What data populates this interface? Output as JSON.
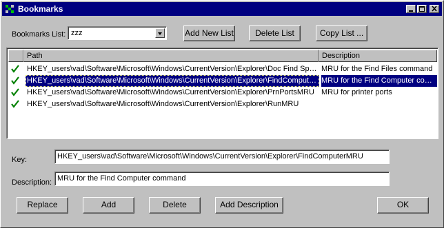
{
  "window": {
    "title": "Bookmarks"
  },
  "bookmarks_list": {
    "label": "Bookmarks List:",
    "selected": "zzz"
  },
  "buttons": {
    "add_new_list": "Add New List",
    "delete_list": "Delete List",
    "copy_list": "Copy List ...",
    "replace": "Replace",
    "add": "Add",
    "delete": "Delete",
    "add_description": "Add Description",
    "ok": "OK"
  },
  "columns": {
    "path": "Path",
    "description": "Description"
  },
  "rows": [
    {
      "path": "HKEY_users\\vad\\Software\\Microsoft\\Windows\\CurrentVersion\\Explorer\\Doc Find Spec MRU",
      "description": "MRU for the Find Files command",
      "selected": false
    },
    {
      "path": "HKEY_users\\vad\\Software\\Microsoft\\Windows\\CurrentVersion\\Explorer\\FindComputerMRU",
      "description": "MRU for the Find Computer command",
      "selected": true
    },
    {
      "path": "HKEY_users\\vad\\Software\\Microsoft\\Windows\\CurrentVersion\\Explorer\\PrnPortsMRU",
      "description": "MRU for printer ports",
      "selected": false
    },
    {
      "path": "HKEY_users\\vad\\Software\\Microsoft\\Windows\\CurrentVersion\\Explorer\\RunMRU",
      "description": "",
      "selected": false
    }
  ],
  "key": {
    "label": "Key:",
    "value": "HKEY_users\\vad\\Software\\Microsoft\\Windows\\CurrentVersion\\Explorer\\FindComputerMRU"
  },
  "description": {
    "label": "Description:",
    "value": "MRU for the Find Computer command"
  },
  "colors": {
    "titlebar": "#000080",
    "selection": "#000080",
    "check": "#008000",
    "face": "#c0c0c0"
  },
  "icons": {
    "app": "registry-tree-icon",
    "row_state": "checkmark-icon"
  }
}
